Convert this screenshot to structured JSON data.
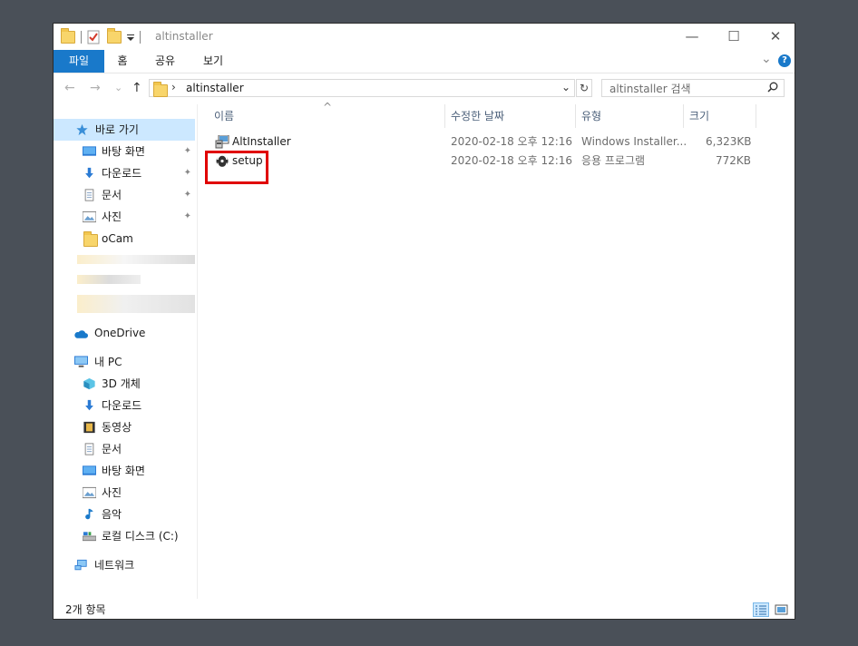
{
  "window": {
    "title": "altinstaller",
    "minimize": "—",
    "maximize": "☐",
    "close": "✕"
  },
  "ribbon": {
    "tabs": [
      "파일",
      "홈",
      "공유",
      "보기"
    ],
    "help": "?",
    "expand_glyph": "⌄"
  },
  "nav": {
    "back": "←",
    "forward": "→",
    "recent": "⌄",
    "up": "↑",
    "chevron": "›",
    "address": "altinstaller",
    "address_dropdown": "⌄",
    "refresh": "↻",
    "search_placeholder": "altinstaller 검색"
  },
  "sidebar": {
    "quick_access": "바로 가기",
    "quick_items": [
      {
        "label": "바탕 화면",
        "icon": "desktop-icon",
        "pinned": true
      },
      {
        "label": "다운로드",
        "icon": "download-icon",
        "pinned": true
      },
      {
        "label": "문서",
        "icon": "documents-icon",
        "pinned": true
      },
      {
        "label": "사진",
        "icon": "pictures-icon",
        "pinned": true
      },
      {
        "label": "oCam",
        "icon": "folder-icon",
        "pinned": false
      }
    ],
    "onedrive": "OneDrive",
    "this_pc": "내 PC",
    "pc_items": [
      {
        "label": "3D 개체",
        "icon": "3d-objects-icon"
      },
      {
        "label": "다운로드",
        "icon": "download-icon"
      },
      {
        "label": "동영상",
        "icon": "videos-icon"
      },
      {
        "label": "문서",
        "icon": "documents-icon"
      },
      {
        "label": "바탕 화면",
        "icon": "desktop-icon"
      },
      {
        "label": "사진",
        "icon": "pictures-icon"
      },
      {
        "label": "음악",
        "icon": "music-icon"
      },
      {
        "label": "로컬 디스크 (C:)",
        "icon": "drive-icon"
      }
    ],
    "network": "네트워크",
    "pin_glyph": "📌"
  },
  "columns": {
    "name": "이름",
    "date": "수정한 날짜",
    "type": "유형",
    "size": "크기",
    "sort_glyph": "^"
  },
  "files": [
    {
      "name": "AltInstaller",
      "date": "2020-02-18 오후 12:16",
      "type": "Windows Installer...",
      "size": "6,323KB",
      "icon": "msi-installer-icon"
    },
    {
      "name": "setup",
      "date": "2020-02-18 오후 12:16",
      "type": "응용 프로그램",
      "size": "772KB",
      "icon": "setup-exe-icon"
    }
  ],
  "status": {
    "count": "2개 항목"
  },
  "colors": {
    "accent": "#1979ca",
    "selection": "#cce8ff",
    "highlight": "#e00000",
    "background": "#4a5058"
  }
}
